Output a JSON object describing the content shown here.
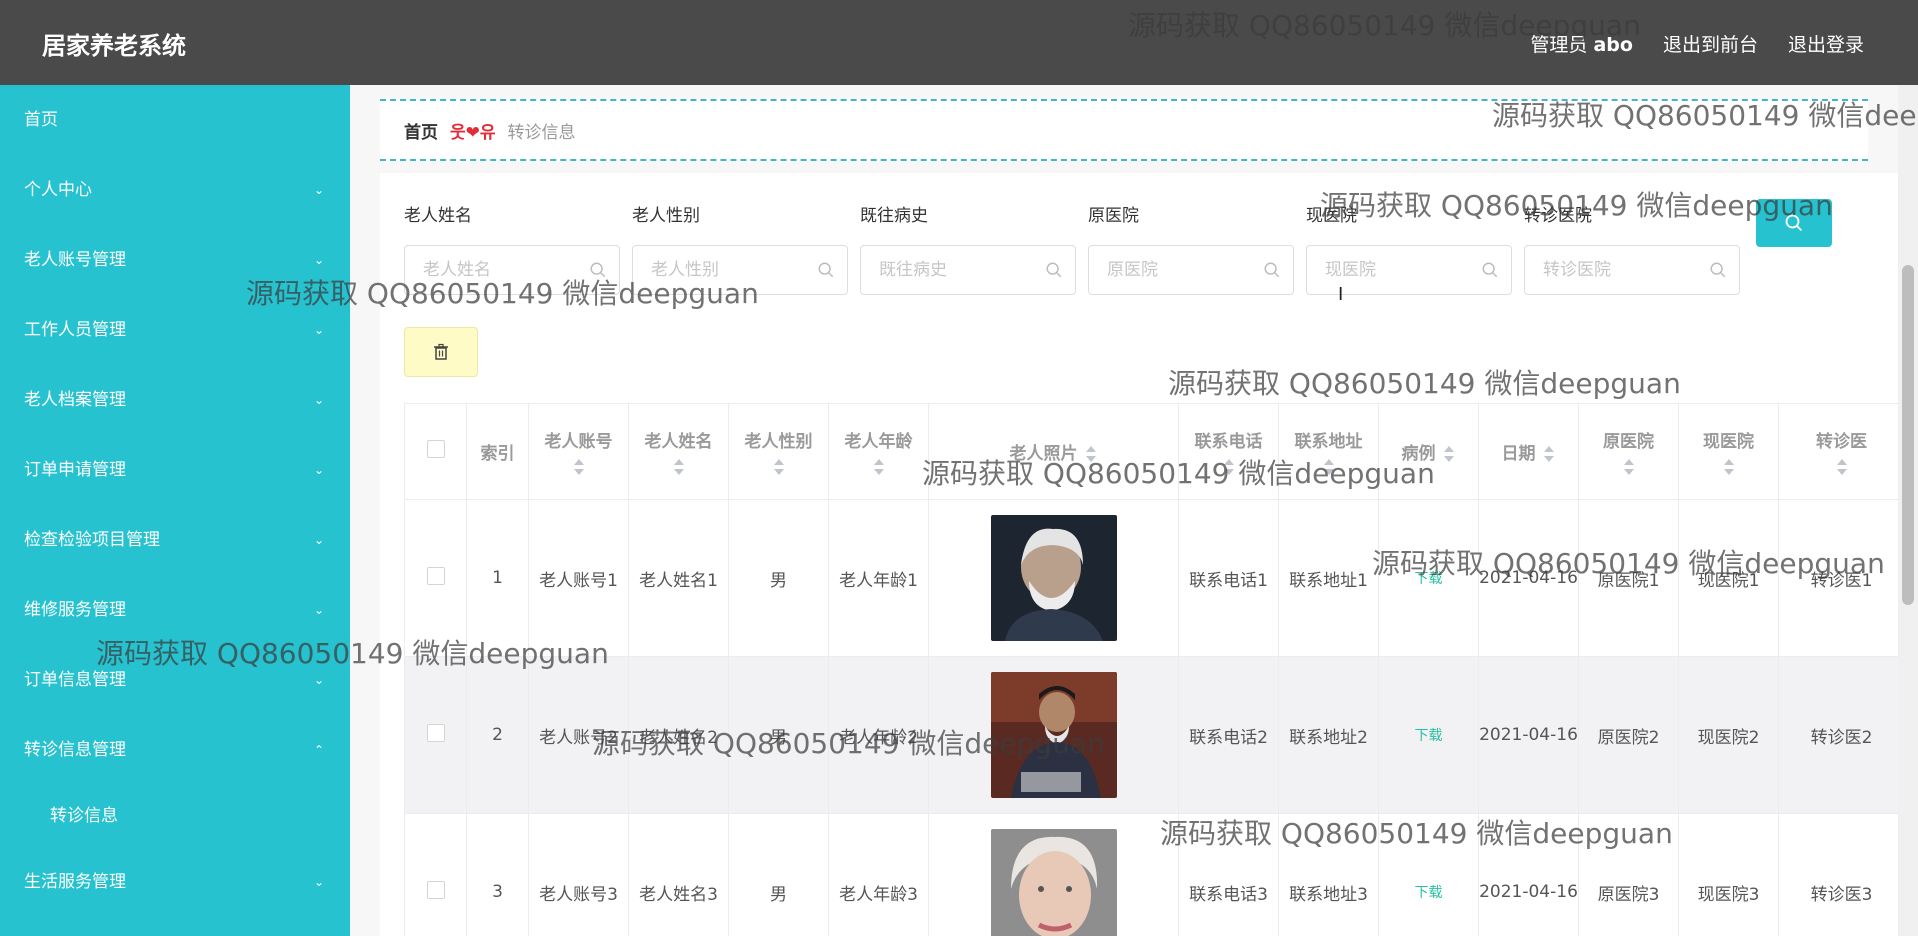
{
  "app": {
    "title": "居家养老系统"
  },
  "topbar": {
    "admin_label": "管理员",
    "admin_name": "abo",
    "back_to_front": "退出到前台",
    "logout": "退出登录"
  },
  "sidebar": {
    "items": [
      {
        "label": "首页"
      },
      {
        "label": "个人中心"
      },
      {
        "label": "老人账号管理"
      },
      {
        "label": "工作人员管理"
      },
      {
        "label": "老人档案管理"
      },
      {
        "label": "订单申请管理"
      },
      {
        "label": "检查检验项目管理"
      },
      {
        "label": "维修服务管理"
      },
      {
        "label": "订单信息管理"
      },
      {
        "label": "转诊信息管理"
      },
      {
        "label": "转诊信息"
      },
      {
        "label": "生活服务管理"
      }
    ]
  },
  "breadcrumb": {
    "home": "首页",
    "separator": "웃❤유",
    "current": "转诊信息"
  },
  "search": {
    "fields": [
      {
        "label": "老人姓名",
        "placeholder": "老人姓名"
      },
      {
        "label": "老人性别",
        "placeholder": "老人性别"
      },
      {
        "label": "既往病史",
        "placeholder": "既往病史"
      },
      {
        "label": "原医院",
        "placeholder": "原医院"
      },
      {
        "label": "现医院",
        "placeholder": "现医院"
      },
      {
        "label": "转诊医院",
        "placeholder": "转诊医院"
      }
    ]
  },
  "table": {
    "headers": {
      "index": "索引",
      "account": "老人账号",
      "name": "老人姓名",
      "gender": "老人性别",
      "age": "老人年龄",
      "photo": "老人照片",
      "phone": "联系电话",
      "address": "联系地址",
      "case": "病例",
      "date": "日期",
      "orig_hospital": "原医院",
      "curr_hospital": "现医院",
      "transfer_hospital": "转诊医"
    },
    "rows": [
      {
        "index": "1",
        "account": "老人账号1",
        "name": "老人姓名1",
        "gender": "男",
        "age": "老人年龄1",
        "phone": "联系电话1",
        "address": "联系地址1",
        "case": "下载",
        "date": "2021-04-16",
        "orig": "原医院1",
        "curr": "现医院1",
        "transfer": "转诊医1"
      },
      {
        "index": "2",
        "account": "老人账号2",
        "name": "老人姓名2",
        "gender": "男",
        "age": "老人年龄2",
        "phone": "联系电话2",
        "address": "联系地址2",
        "case": "下载",
        "date": "2021-04-16",
        "orig": "原医院2",
        "curr": "现医院2",
        "transfer": "转诊医2"
      },
      {
        "index": "3",
        "account": "老人账号3",
        "name": "老人姓名3",
        "gender": "男",
        "age": "老人年龄3",
        "phone": "联系电话3",
        "address": "联系地址3",
        "case": "下载",
        "date": "2021-04-16",
        "orig": "原医院3",
        "curr": "现医院3",
        "transfer": "转诊医3"
      }
    ]
  },
  "watermark": "源码获取 QQ86050149 微信deepguan",
  "colors": {
    "sidebar": "#27c2cf",
    "topbar": "#4a4a4a",
    "link": "#27c2a4"
  }
}
